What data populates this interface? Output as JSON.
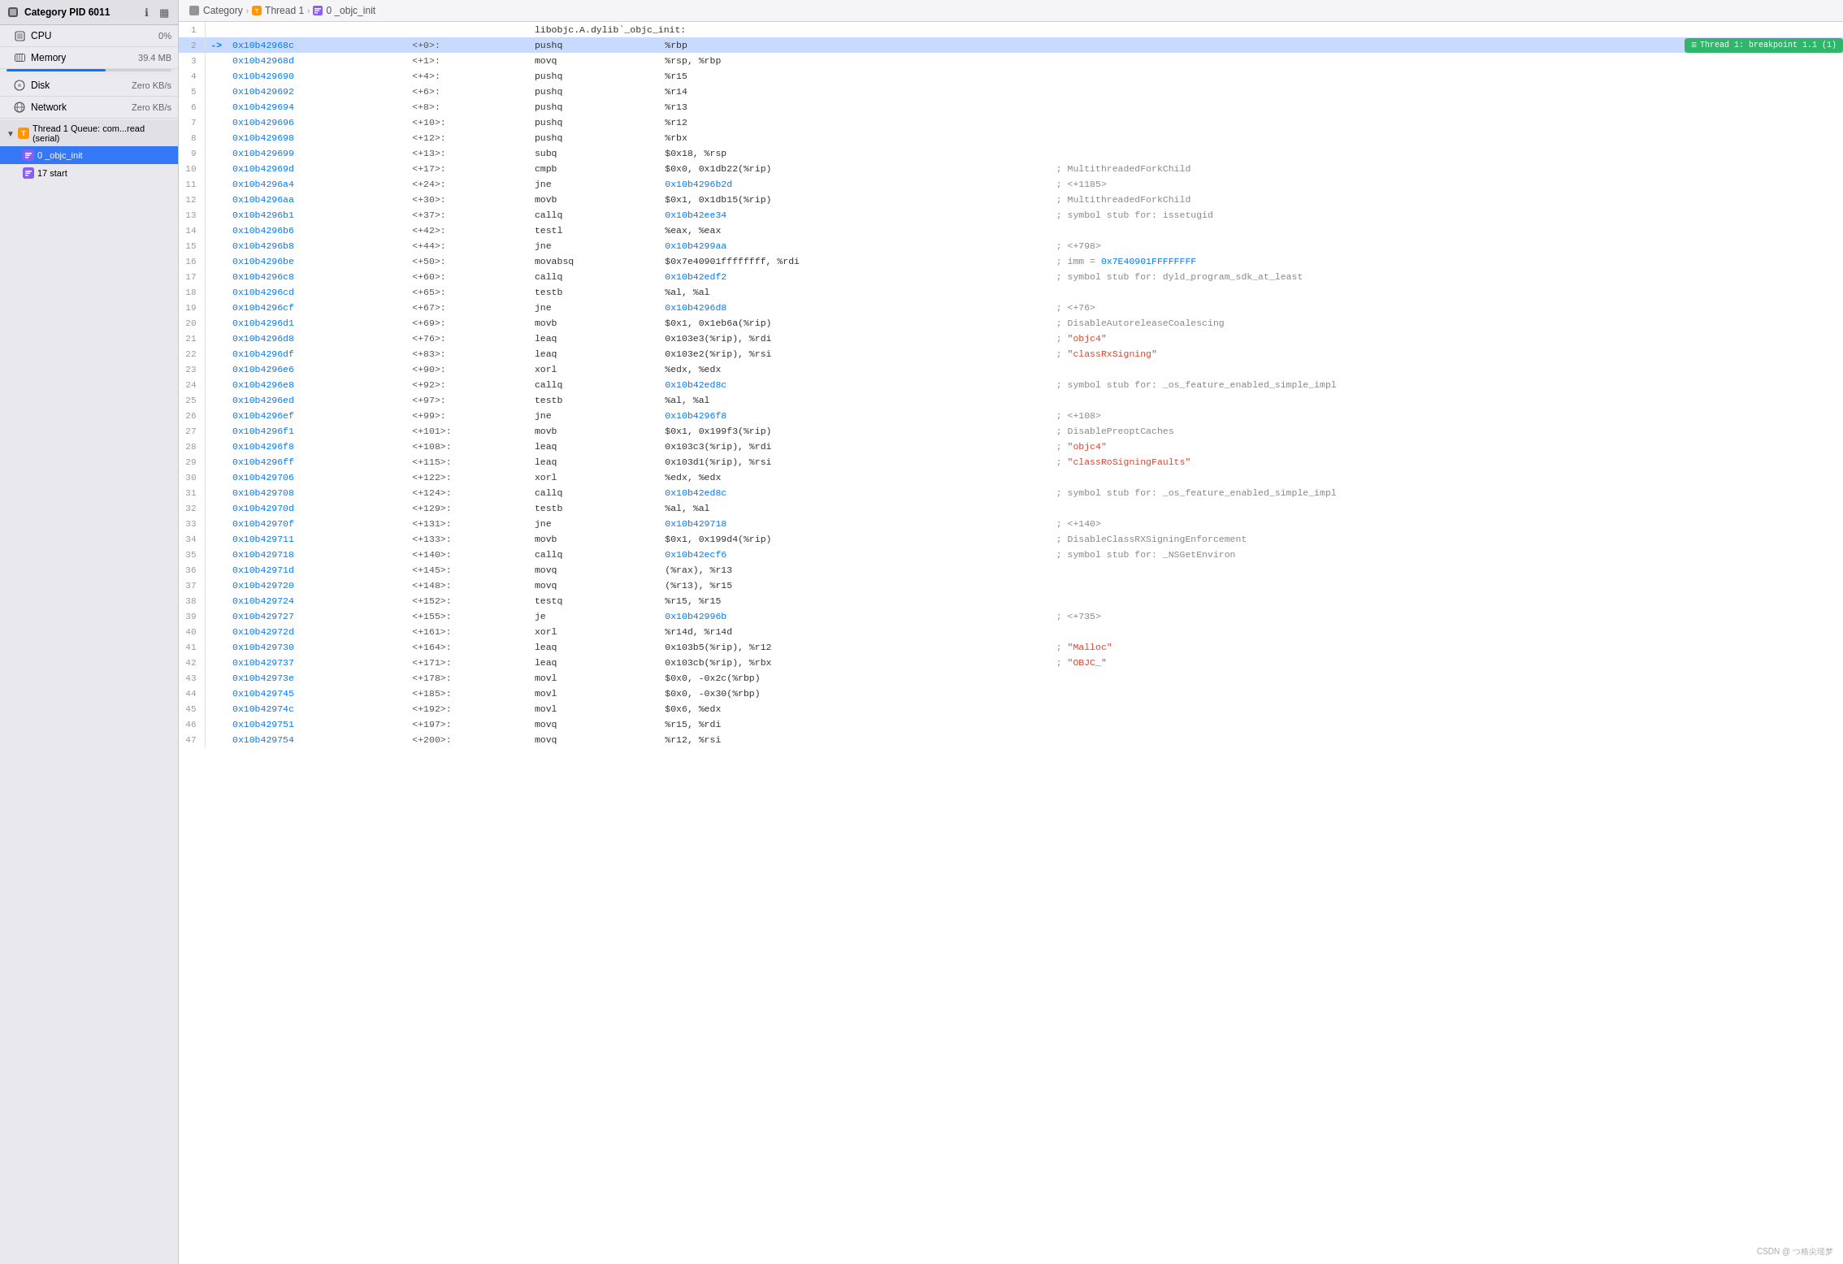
{
  "sidebar": {
    "header": {
      "title": "Category PID 6011",
      "icons": [
        "ℹ",
        "▦"
      ]
    },
    "items": [
      {
        "id": "cpu",
        "label": "CPU",
        "value": "0%",
        "icon": "cpu"
      },
      {
        "id": "memory",
        "label": "Memory",
        "value": "39.4 MB",
        "icon": "memory"
      },
      {
        "id": "disk",
        "label": "Disk",
        "value": "Zero KB/s",
        "icon": "disk"
      },
      {
        "id": "network",
        "label": "Network",
        "value": "Zero KB/s",
        "icon": "network"
      }
    ],
    "thread_section": {
      "label": "Thread 1 Queue: com...read (serial)",
      "children": [
        {
          "id": "objc_init",
          "label": "0 _objc_init",
          "selected": true
        },
        {
          "id": "start",
          "label": "17 start",
          "selected": false
        }
      ]
    }
  },
  "breadcrumb": {
    "items": [
      {
        "label": "Category",
        "icon": "chevron"
      },
      {
        "label": "Thread 1",
        "icon": "thread"
      },
      {
        "label": "0 _objc_init",
        "icon": "func"
      }
    ]
  },
  "code": {
    "header_line": "libobjc.A.dylib`_objc_init:",
    "breakpoint_label": "Thread 1: breakpoint 1.1 (1)",
    "rows": [
      {
        "line": 1,
        "arrow": "",
        "addr": "",
        "offset": "",
        "op": "libobjc.A.dylib`_objc_init:",
        "operand": "",
        "comment": "",
        "active": false
      },
      {
        "line": 2,
        "arrow": "->",
        "addr": "0x10b42968c",
        "offset": "<+0>:",
        "op": "pushq",
        "operand": "%rbp",
        "comment": "",
        "active": true,
        "breakpoint": true
      },
      {
        "line": 3,
        "arrow": "",
        "addr": "0x10b42968d",
        "offset": "<+1>:",
        "op": "movq",
        "operand": "%rsp, %rbp",
        "comment": "",
        "active": false
      },
      {
        "line": 4,
        "arrow": "",
        "addr": "0x10b429690",
        "offset": "<+4>:",
        "op": "pushq",
        "operand": "%r15",
        "comment": "",
        "active": false
      },
      {
        "line": 5,
        "arrow": "",
        "addr": "0x10b429692",
        "offset": "<+6>:",
        "op": "pushq",
        "operand": "%r14",
        "comment": "",
        "active": false
      },
      {
        "line": 6,
        "arrow": "",
        "addr": "0x10b429694",
        "offset": "<+8>:",
        "op": "pushq",
        "operand": "%r13",
        "comment": "",
        "active": false
      },
      {
        "line": 7,
        "arrow": "",
        "addr": "0x10b429696",
        "offset": "<+10>:",
        "op": "pushq",
        "operand": "%r12",
        "comment": "",
        "active": false
      },
      {
        "line": 8,
        "arrow": "",
        "addr": "0x10b429698",
        "offset": "<+12>:",
        "op": "pushq",
        "operand": "%rbx",
        "comment": "",
        "active": false
      },
      {
        "line": 9,
        "arrow": "",
        "addr": "0x10b429699",
        "offset": "<+13>:",
        "op": "subq",
        "operand": "$0x18, %rsp",
        "comment": "",
        "active": false
      },
      {
        "line": 10,
        "arrow": "",
        "addr": "0x10b42969d",
        "offset": "<+17>:",
        "op": "cmpb",
        "operand": "$0x0, 0x1db22(%rip)",
        "comment": "; MultithreadedForkChild",
        "comment_type": "plain",
        "active": false
      },
      {
        "line": 11,
        "arrow": "",
        "addr": "0x10b4296a4",
        "offset": "<+24>:",
        "op": "jne",
        "operand": "0x10b4296b2d",
        "comment": "; <+1185>",
        "comment_type": "plain",
        "active": false,
        "operand_link": true
      },
      {
        "line": 12,
        "arrow": "",
        "addr": "0x10b4296aa",
        "offset": "<+30>:",
        "op": "movb",
        "operand": "$0x1, 0x1db15(%rip)",
        "comment": "; MultithreadedForkChild",
        "comment_type": "plain",
        "active": false
      },
      {
        "line": 13,
        "arrow": "",
        "addr": "0x10b4296b1",
        "offset": "<+37>:",
        "op": "callq",
        "operand": "0x10b42ee34",
        "comment": "; symbol stub for: issetugid",
        "comment_type": "plain",
        "active": false,
        "operand_link": true
      },
      {
        "line": 14,
        "arrow": "",
        "addr": "0x10b4296b6",
        "offset": "<+42>:",
        "op": "testl",
        "operand": "%eax, %eax",
        "comment": "",
        "active": false
      },
      {
        "line": 15,
        "arrow": "",
        "addr": "0x10b4296b8",
        "offset": "<+44>:",
        "op": "jne",
        "operand": "0x10b4299aa",
        "comment": "; <+798>",
        "comment_type": "plain",
        "active": false,
        "operand_link": true
      },
      {
        "line": 16,
        "arrow": "",
        "addr": "0x10b4296be",
        "offset": "<+50>:",
        "op": "movabsq",
        "operand": "$0x7e40901ffffffff, %rdi",
        "comment": "; imm = 0x7E40901FFFFFFFF",
        "comment_type": "hex",
        "active": false
      },
      {
        "line": 17,
        "arrow": "",
        "addr": "0x10b4296c8",
        "offset": "<+60>:",
        "op": "callq",
        "operand": "0x10b42edf2",
        "comment": "; symbol stub for: dyld_program_sdk_at_least",
        "comment_type": "plain",
        "active": false,
        "operand_link": true
      },
      {
        "line": 18,
        "arrow": "",
        "addr": "0x10b4296cd",
        "offset": "<+65>:",
        "op": "testb",
        "operand": "%al, %al",
        "comment": "",
        "active": false
      },
      {
        "line": 19,
        "arrow": "",
        "addr": "0x10b4296cf",
        "offset": "<+67>:",
        "op": "jne",
        "operand": "0x10b4296d8",
        "comment": "; <+76>",
        "comment_type": "plain",
        "active": false,
        "operand_link": true
      },
      {
        "line": 20,
        "arrow": "",
        "addr": "0x10b4296d1",
        "offset": "<+69>:",
        "op": "movb",
        "operand": "$0x1, 0x1eb6a(%rip)",
        "comment": "; DisableAutoreleaseCoalescing",
        "comment_type": "plain",
        "active": false
      },
      {
        "line": 21,
        "arrow": "",
        "addr": "0x10b4296d8",
        "offset": "<+76>:",
        "op": "leaq",
        "operand": "0x103e3(%rip), %rdi",
        "comment": "; \"objc4\"",
        "comment_type": "string",
        "active": false
      },
      {
        "line": 22,
        "arrow": "",
        "addr": "0x10b4296df",
        "offset": "<+83>:",
        "op": "leaq",
        "operand": "0x103e2(%rip), %rsi",
        "comment": "; \"classRxSigning\"",
        "comment_type": "string",
        "active": false
      },
      {
        "line": 23,
        "arrow": "",
        "addr": "0x10b4296e6",
        "offset": "<+90>:",
        "op": "xorl",
        "operand": "%edx, %edx",
        "comment": "",
        "active": false
      },
      {
        "line": 24,
        "arrow": "",
        "addr": "0x10b4296e8",
        "offset": "<+92>:",
        "op": "callq",
        "operand": "0x10b42ed8c",
        "comment": "; symbol stub for: _os_feature_enabled_simple_impl",
        "comment_type": "plain",
        "active": false,
        "operand_link": true
      },
      {
        "line": 25,
        "arrow": "",
        "addr": "0x10b4296ed",
        "offset": "<+97>:",
        "op": "testb",
        "operand": "%al, %al",
        "comment": "",
        "active": false
      },
      {
        "line": 26,
        "arrow": "",
        "addr": "0x10b4296ef",
        "offset": "<+99>:",
        "op": "jne",
        "operand": "0x10b4296f8",
        "comment": "; <+108>",
        "comment_type": "plain",
        "active": false,
        "operand_link": true
      },
      {
        "line": 27,
        "arrow": "",
        "addr": "0x10b4296f1",
        "offset": "<+101>:",
        "op": "movb",
        "operand": "$0x1, 0x199f3(%rip)",
        "comment": "; DisablePreoptCaches",
        "comment_type": "plain",
        "active": false
      },
      {
        "line": 28,
        "arrow": "",
        "addr": "0x10b4296f8",
        "offset": "<+108>:",
        "op": "leaq",
        "operand": "0x103c3(%rip), %rdi",
        "comment": "; \"objc4\"",
        "comment_type": "string",
        "active": false
      },
      {
        "line": 29,
        "arrow": "",
        "addr": "0x10b4296ff",
        "offset": "<+115>:",
        "op": "leaq",
        "operand": "0x103d1(%rip), %rsi",
        "comment": "; \"classRoSigningFaults\"",
        "comment_type": "string",
        "active": false
      },
      {
        "line": 30,
        "arrow": "",
        "addr": "0x10b429706",
        "offset": "<+122>:",
        "op": "xorl",
        "operand": "%edx, %edx",
        "comment": "",
        "active": false
      },
      {
        "line": 31,
        "arrow": "",
        "addr": "0x10b429708",
        "offset": "<+124>:",
        "op": "callq",
        "operand": "0x10b42ed8c",
        "comment": "; symbol stub for: _os_feature_enabled_simple_impl",
        "comment_type": "plain",
        "active": false,
        "operand_link": true
      },
      {
        "line": 32,
        "arrow": "",
        "addr": "0x10b42970d",
        "offset": "<+129>:",
        "op": "testb",
        "operand": "%al, %al",
        "comment": "",
        "active": false
      },
      {
        "line": 33,
        "arrow": "",
        "addr": "0x10b42970f",
        "offset": "<+131>:",
        "op": "jne",
        "operand": "0x10b429718",
        "comment": "; <+140>",
        "comment_type": "plain",
        "active": false,
        "operand_link": true
      },
      {
        "line": 34,
        "arrow": "",
        "addr": "0x10b429711",
        "offset": "<+133>:",
        "op": "movb",
        "operand": "$0x1, 0x199d4(%rip)",
        "comment": "; DisableClassRXSigningEnforcement",
        "comment_type": "plain",
        "active": false
      },
      {
        "line": 35,
        "arrow": "",
        "addr": "0x10b429718",
        "offset": "<+140>:",
        "op": "callq",
        "operand": "0x10b42ecf6",
        "comment": "; symbol stub for: _NSGetEnviron",
        "comment_type": "plain",
        "active": false,
        "operand_link": true
      },
      {
        "line": 36,
        "arrow": "",
        "addr": "0x10b42971d",
        "offset": "<+145>:",
        "op": "movq",
        "operand": "(%rax), %r13",
        "comment": "",
        "active": false
      },
      {
        "line": 37,
        "arrow": "",
        "addr": "0x10b429720",
        "offset": "<+148>:",
        "op": "movq",
        "operand": "(%r13), %r15",
        "comment": "",
        "active": false
      },
      {
        "line": 38,
        "arrow": "",
        "addr": "0x10b429724",
        "offset": "<+152>:",
        "op": "testq",
        "operand": "%r15, %r15",
        "comment": "",
        "active": false
      },
      {
        "line": 39,
        "arrow": "",
        "addr": "0x10b429727",
        "offset": "<+155>:",
        "op": "je",
        "operand": "0x10b42996b",
        "comment": "; <+735>",
        "comment_type": "plain",
        "active": false,
        "operand_link": true
      },
      {
        "line": 40,
        "arrow": "",
        "addr": "0x10b42972d",
        "offset": "<+161>:",
        "op": "xorl",
        "operand": "%r14d, %r14d",
        "comment": "",
        "active": false
      },
      {
        "line": 41,
        "arrow": "",
        "addr": "0x10b429730",
        "offset": "<+164>:",
        "op": "leaq",
        "operand": "0x103b5(%rip), %r12",
        "comment": "; \"Malloc\"",
        "comment_type": "string",
        "active": false
      },
      {
        "line": 42,
        "arrow": "",
        "addr": "0x10b429737",
        "offset": "<+171>:",
        "op": "leaq",
        "operand": "0x103cb(%rip), %rbx",
        "comment": "; \"OBJC_\"",
        "comment_type": "string",
        "active": false
      },
      {
        "line": 43,
        "arrow": "",
        "addr": "0x10b42973e",
        "offset": "<+178>:",
        "op": "movl",
        "operand": "$0x0, -0x2c(%rbp)",
        "comment": "",
        "active": false
      },
      {
        "line": 44,
        "arrow": "",
        "addr": "0x10b429745",
        "offset": "<+185>:",
        "op": "movl",
        "operand": "$0x0, -0x30(%rbp)",
        "comment": "",
        "active": false
      },
      {
        "line": 45,
        "arrow": "",
        "addr": "0x10b42974c",
        "offset": "<+192>:",
        "op": "movl",
        "operand": "$0x6, %edx",
        "comment": "",
        "active": false
      },
      {
        "line": 46,
        "arrow": "",
        "addr": "0x10b429751",
        "offset": "<+197>:",
        "op": "movq",
        "operand": "%r15, %rdi",
        "comment": "",
        "active": false
      },
      {
        "line": 47,
        "arrow": "",
        "addr": "0x10b429754",
        "offset": "<+200>:",
        "op": "movq",
        "operand": "%r12, %rsi",
        "comment": "",
        "active": false
      }
    ]
  },
  "watermark": "CSDN @ つ格尖瑶梦"
}
